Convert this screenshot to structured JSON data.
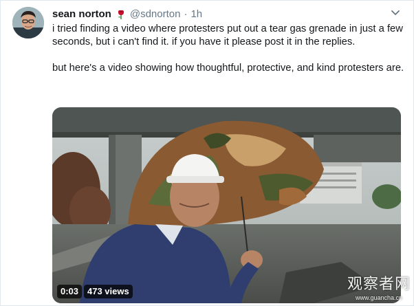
{
  "tweet": {
    "author_name": "sean norton",
    "author_emoji_icon": "rose-icon",
    "handle": "@sdnorton",
    "separator": "·",
    "time": "1h",
    "menu_icon": "chevron-down-icon",
    "text": "i tried finding a video where protesters put out a tear gas grenade in just a few seconds, but i can't find it. if you have it please post it in the replies.\n\nbut here's a video showing how thoughtful, protective, and kind protesters are."
  },
  "video": {
    "duration": "0:03",
    "views": "473 views",
    "icon": "video-thumbnail"
  },
  "watermark": {
    "title": "观察者网",
    "url": "www.guancha.cn"
  },
  "colors": {
    "text_primary": "#14171a",
    "text_secondary": "#657786",
    "border": "#e1e8ed"
  }
}
